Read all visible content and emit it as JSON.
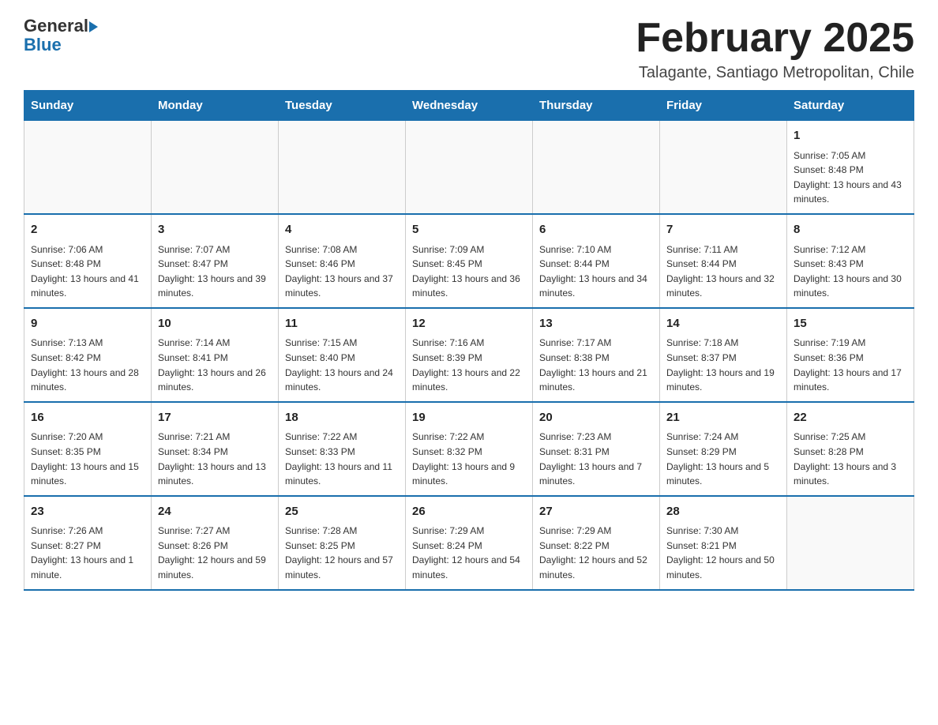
{
  "header": {
    "logo_general": "General",
    "logo_blue": "Blue",
    "title": "February 2025",
    "location": "Talagante, Santiago Metropolitan, Chile"
  },
  "days_of_week": [
    "Sunday",
    "Monday",
    "Tuesday",
    "Wednesday",
    "Thursday",
    "Friday",
    "Saturday"
  ],
  "weeks": [
    [
      {
        "day": "",
        "info": ""
      },
      {
        "day": "",
        "info": ""
      },
      {
        "day": "",
        "info": ""
      },
      {
        "day": "",
        "info": ""
      },
      {
        "day": "",
        "info": ""
      },
      {
        "day": "",
        "info": ""
      },
      {
        "day": "1",
        "info": "Sunrise: 7:05 AM\nSunset: 8:48 PM\nDaylight: 13 hours and 43 minutes."
      }
    ],
    [
      {
        "day": "2",
        "info": "Sunrise: 7:06 AM\nSunset: 8:48 PM\nDaylight: 13 hours and 41 minutes."
      },
      {
        "day": "3",
        "info": "Sunrise: 7:07 AM\nSunset: 8:47 PM\nDaylight: 13 hours and 39 minutes."
      },
      {
        "day": "4",
        "info": "Sunrise: 7:08 AM\nSunset: 8:46 PM\nDaylight: 13 hours and 37 minutes."
      },
      {
        "day": "5",
        "info": "Sunrise: 7:09 AM\nSunset: 8:45 PM\nDaylight: 13 hours and 36 minutes."
      },
      {
        "day": "6",
        "info": "Sunrise: 7:10 AM\nSunset: 8:44 PM\nDaylight: 13 hours and 34 minutes."
      },
      {
        "day": "7",
        "info": "Sunrise: 7:11 AM\nSunset: 8:44 PM\nDaylight: 13 hours and 32 minutes."
      },
      {
        "day": "8",
        "info": "Sunrise: 7:12 AM\nSunset: 8:43 PM\nDaylight: 13 hours and 30 minutes."
      }
    ],
    [
      {
        "day": "9",
        "info": "Sunrise: 7:13 AM\nSunset: 8:42 PM\nDaylight: 13 hours and 28 minutes."
      },
      {
        "day": "10",
        "info": "Sunrise: 7:14 AM\nSunset: 8:41 PM\nDaylight: 13 hours and 26 minutes."
      },
      {
        "day": "11",
        "info": "Sunrise: 7:15 AM\nSunset: 8:40 PM\nDaylight: 13 hours and 24 minutes."
      },
      {
        "day": "12",
        "info": "Sunrise: 7:16 AM\nSunset: 8:39 PM\nDaylight: 13 hours and 22 minutes."
      },
      {
        "day": "13",
        "info": "Sunrise: 7:17 AM\nSunset: 8:38 PM\nDaylight: 13 hours and 21 minutes."
      },
      {
        "day": "14",
        "info": "Sunrise: 7:18 AM\nSunset: 8:37 PM\nDaylight: 13 hours and 19 minutes."
      },
      {
        "day": "15",
        "info": "Sunrise: 7:19 AM\nSunset: 8:36 PM\nDaylight: 13 hours and 17 minutes."
      }
    ],
    [
      {
        "day": "16",
        "info": "Sunrise: 7:20 AM\nSunset: 8:35 PM\nDaylight: 13 hours and 15 minutes."
      },
      {
        "day": "17",
        "info": "Sunrise: 7:21 AM\nSunset: 8:34 PM\nDaylight: 13 hours and 13 minutes."
      },
      {
        "day": "18",
        "info": "Sunrise: 7:22 AM\nSunset: 8:33 PM\nDaylight: 13 hours and 11 minutes."
      },
      {
        "day": "19",
        "info": "Sunrise: 7:22 AM\nSunset: 8:32 PM\nDaylight: 13 hours and 9 minutes."
      },
      {
        "day": "20",
        "info": "Sunrise: 7:23 AM\nSunset: 8:31 PM\nDaylight: 13 hours and 7 minutes."
      },
      {
        "day": "21",
        "info": "Sunrise: 7:24 AM\nSunset: 8:29 PM\nDaylight: 13 hours and 5 minutes."
      },
      {
        "day": "22",
        "info": "Sunrise: 7:25 AM\nSunset: 8:28 PM\nDaylight: 13 hours and 3 minutes."
      }
    ],
    [
      {
        "day": "23",
        "info": "Sunrise: 7:26 AM\nSunset: 8:27 PM\nDaylight: 13 hours and 1 minute."
      },
      {
        "day": "24",
        "info": "Sunrise: 7:27 AM\nSunset: 8:26 PM\nDaylight: 12 hours and 59 minutes."
      },
      {
        "day": "25",
        "info": "Sunrise: 7:28 AM\nSunset: 8:25 PM\nDaylight: 12 hours and 57 minutes."
      },
      {
        "day": "26",
        "info": "Sunrise: 7:29 AM\nSunset: 8:24 PM\nDaylight: 12 hours and 54 minutes."
      },
      {
        "day": "27",
        "info": "Sunrise: 7:29 AM\nSunset: 8:22 PM\nDaylight: 12 hours and 52 minutes."
      },
      {
        "day": "28",
        "info": "Sunrise: 7:30 AM\nSunset: 8:21 PM\nDaylight: 12 hours and 50 minutes."
      },
      {
        "day": "",
        "info": ""
      }
    ]
  ]
}
